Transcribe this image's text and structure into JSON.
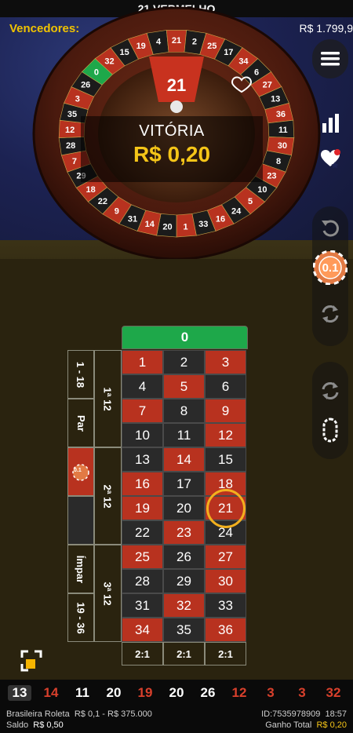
{
  "header": {
    "title": "21 VERMELHO"
  },
  "winners": {
    "label": "Vencedores:",
    "amount": "R$ 1.799,9"
  },
  "wheel": {
    "result": "21",
    "wheel_numbers_top": [
      "32",
      "15",
      "19",
      "4",
      "21",
      "2",
      "25",
      "17",
      "34",
      "6",
      "27",
      "13",
      "36",
      "11",
      "30",
      "8",
      "23",
      "10",
      "5",
      "24",
      "16",
      "33",
      "1",
      "20",
      "14",
      "31",
      "9",
      "22",
      "18",
      "29",
      "7",
      "28",
      "12",
      "35",
      "3",
      "26",
      "0"
    ]
  },
  "victory": {
    "label": "VITÓRIA",
    "amount": "R$ 0,20"
  },
  "chip": {
    "value": "0.1"
  },
  "board": {
    "zero": "0",
    "rows": [
      [
        {
          "n": "1",
          "c": "red"
        },
        {
          "n": "2",
          "c": "black"
        },
        {
          "n": "3",
          "c": "red"
        }
      ],
      [
        {
          "n": "4",
          "c": "black"
        },
        {
          "n": "5",
          "c": "red"
        },
        {
          "n": "6",
          "c": "black"
        }
      ],
      [
        {
          "n": "7",
          "c": "red"
        },
        {
          "n": "8",
          "c": "black"
        },
        {
          "n": "9",
          "c": "red"
        }
      ],
      [
        {
          "n": "10",
          "c": "black"
        },
        {
          "n": "11",
          "c": "black"
        },
        {
          "n": "12",
          "c": "red"
        }
      ],
      [
        {
          "n": "13",
          "c": "black"
        },
        {
          "n": "14",
          "c": "red"
        },
        {
          "n": "15",
          "c": "black"
        }
      ],
      [
        {
          "n": "16",
          "c": "red"
        },
        {
          "n": "17",
          "c": "black"
        },
        {
          "n": "18",
          "c": "red"
        }
      ],
      [
        {
          "n": "19",
          "c": "red"
        },
        {
          "n": "20",
          "c": "black"
        },
        {
          "n": "21",
          "c": "red"
        }
      ],
      [
        {
          "n": "22",
          "c": "black"
        },
        {
          "n": "23",
          "c": "red"
        },
        {
          "n": "24",
          "c": "black"
        }
      ],
      [
        {
          "n": "25",
          "c": "red"
        },
        {
          "n": "26",
          "c": "black"
        },
        {
          "n": "27",
          "c": "red"
        }
      ],
      [
        {
          "n": "28",
          "c": "black"
        },
        {
          "n": "29",
          "c": "black"
        },
        {
          "n": "30",
          "c": "red"
        }
      ],
      [
        {
          "n": "31",
          "c": "black"
        },
        {
          "n": "32",
          "c": "red"
        },
        {
          "n": "33",
          "c": "black"
        }
      ],
      [
        {
          "n": "34",
          "c": "red"
        },
        {
          "n": "35",
          "c": "black"
        },
        {
          "n": "36",
          "c": "red"
        }
      ]
    ],
    "dozens": [
      "1ª 12",
      "2ª 12",
      "3ª 12"
    ],
    "outside": [
      "1 - 18",
      "Par",
      "",
      "Ímpar",
      "19 - 36"
    ],
    "columns": [
      "2:1",
      "2:1",
      "2:1"
    ],
    "placed_chip": "0.1"
  },
  "history": [
    {
      "n": "13",
      "c": "black"
    },
    {
      "n": "14",
      "c": "red"
    },
    {
      "n": "11",
      "c": "black"
    },
    {
      "n": "20",
      "c": "black"
    },
    {
      "n": "19",
      "c": "red"
    },
    {
      "n": "20",
      "c": "black"
    },
    {
      "n": "26",
      "c": "black"
    },
    {
      "n": "12",
      "c": "red"
    },
    {
      "n": "3",
      "c": "red"
    },
    {
      "n": "3",
      "c": "red"
    },
    {
      "n": "32",
      "c": "red"
    }
  ],
  "footer": {
    "game": "Brasileira Roleta",
    "limits": "R$ 0,1 - R$ 375.000",
    "balance_label": "Saldo",
    "balance": "R$ 0,50",
    "id": "ID:7535978909",
    "time": "18:57",
    "total_win_label": "Ganho Total",
    "total_win": "R$ 0,20"
  },
  "colors": {
    "red": "#b8321f",
    "black": "#2a2a2a",
    "green": "#1ea84a",
    "gold": "#f5c518"
  }
}
